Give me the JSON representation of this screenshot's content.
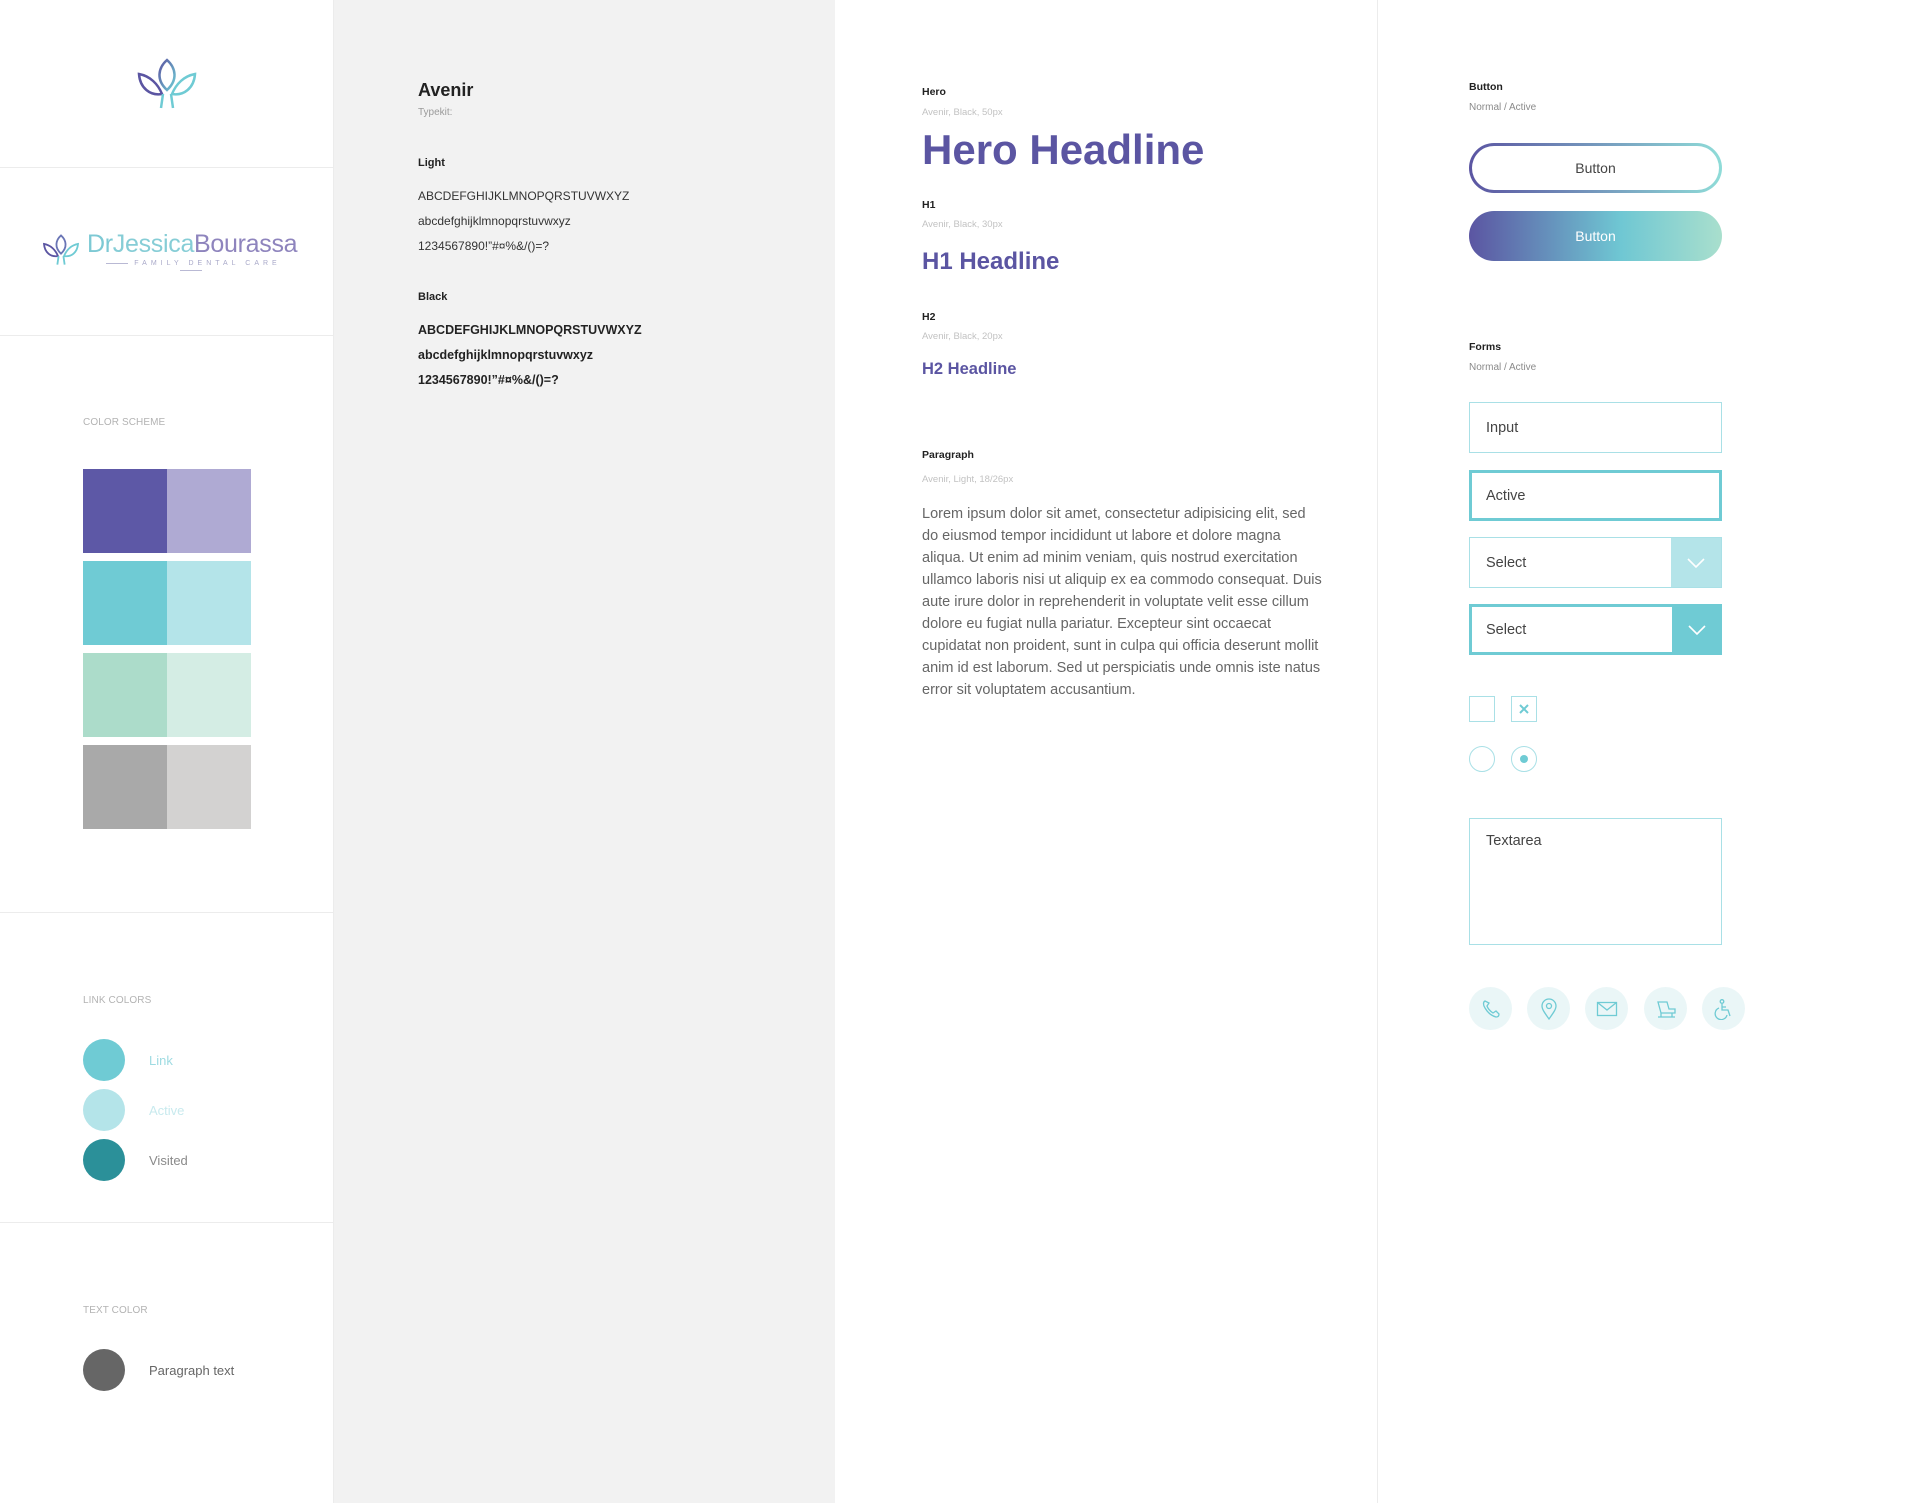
{
  "brand": {
    "logo_name": {
      "dr": "Dr",
      "first": "Jessica",
      "last": "Bourassa"
    },
    "logo_sub": "FAMILY DENTAL CARE"
  },
  "color_scheme": {
    "label": "COLOR SCHEME",
    "rows": [
      [
        "#5d58a6",
        "#afaad3"
      ],
      [
        "#6fcbd4",
        "#b4e4e9"
      ],
      [
        "#acdcca",
        "#d4ede4"
      ],
      [
        "#a9a9a9",
        "#d3d2d1"
      ]
    ]
  },
  "link_colors": {
    "label": "LINK COLORS",
    "items": [
      {
        "label": "Link",
        "dot": "#6fcbd4",
        "text": "#9edbe2"
      },
      {
        "label": "Active",
        "dot": "#b4e4e9",
        "text": "#c8eaee"
      },
      {
        "label": "Visited",
        "dot": "#2b9099",
        "text": "#8a8a8a"
      }
    ]
  },
  "text_color": {
    "label": "TEXT COLOR",
    "item": {
      "label": "Paragraph text",
      "dot": "#666666"
    }
  },
  "typography": {
    "font_name": "Avenir",
    "source": "Typekit:",
    "light": {
      "label": "Light",
      "lines": [
        "ABCDEFGHIJKLMNOPQRSTUVWXYZ",
        "abcdefghijklmnopqrstuvwxyz",
        "1234567890!”#¤%&/()=?"
      ]
    },
    "black": {
      "label": "Black",
      "lines": [
        "ABCDEFGHIJKLMNOPQRSTUVWXYZ",
        "abcdefghijklmnopqrstuvwxyz",
        "1234567890!”#¤%&/()=?"
      ]
    }
  },
  "headlines": {
    "hero": {
      "label": "Hero",
      "spec": "Avenir, Black, 50px",
      "text": "Hero Headline"
    },
    "h1": {
      "label": "H1",
      "spec": "Avenir, Black, 30px",
      "text": "H1 Headline"
    },
    "h2": {
      "label": "H2",
      "spec": "Avenir, Black, 20px",
      "text": "H2 Headline"
    },
    "paragraph": {
      "label": "Paragraph",
      "spec": "Avenir, Light, 18/26px",
      "text": "Lorem ipsum dolor sit amet, consectetur adipisicing elit, sed do eiusmod tempor incididunt ut labore et dolore magna aliqua. Ut enim ad minim veniam, quis nostrud exercitation ullamco laboris nisi ut aliquip ex ea commodo consequat. Duis aute irure dolor in reprehenderit in voluptate velit esse cillum dolore eu fugiat nulla pariatur. Excepteur sint occaecat cupidatat non proident, sunt in culpa qui officia deserunt mollit anim id est laborum. Sed ut perspiciatis unde omnis iste natus error sit voluptatem accusantium."
    }
  },
  "ui": {
    "button_section": {
      "label": "Button",
      "spec": "Normal / Active"
    },
    "button_normal": "Button",
    "button_active": "Button",
    "forms_section": {
      "label": "Forms",
      "spec": "Normal / Active"
    },
    "input_normal": "Input",
    "input_active": "Active",
    "select_normal": "Select",
    "select_active": "Select",
    "textarea": "Textarea",
    "icons": [
      "phone-icon",
      "location-pin-icon",
      "mail-icon",
      "chair-icon",
      "accessibility-icon"
    ]
  }
}
